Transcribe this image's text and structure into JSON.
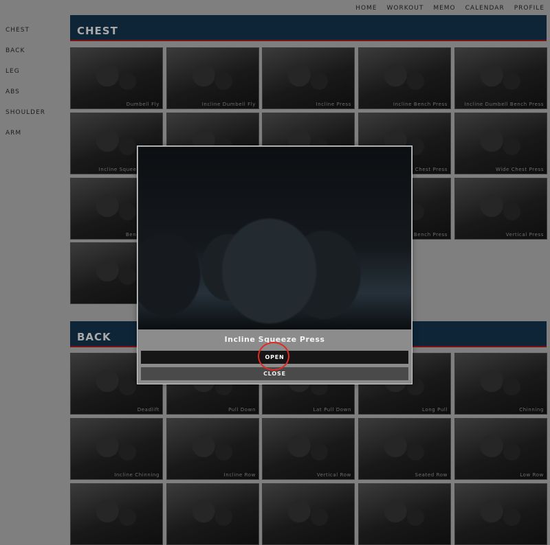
{
  "nav": {
    "items": [
      "HOME",
      "WORKOUT",
      "MEMO",
      "CALENDAR",
      "PROFILE"
    ]
  },
  "sidebar": {
    "items": [
      "CHEST",
      "BACK",
      "LEG",
      "ABS",
      "SHOULDER",
      "ARM"
    ]
  },
  "sections": [
    {
      "title": "CHEST",
      "tiles": [
        "Dumbell Fly",
        "Incline Dumbell Fly",
        "Incline Press",
        "Incline Bench Press",
        "Incline Dumbell Bench Press",
        "Incline Squeeze Press",
        "",
        "",
        "Chest Press",
        "Wide Chest Press",
        "Bench Press",
        "",
        "",
        "Bench Press",
        "Vertical Press",
        ""
      ]
    },
    {
      "title": "BACK",
      "tiles": [
        "Deadlift",
        "Pull Down",
        "Lat Pull Down",
        "Long Pull",
        "Chinning",
        "Incline Chinning",
        "Incline Row",
        "Vertical Row",
        "Seated Row",
        "Low Row",
        "",
        "",
        "",
        "",
        ""
      ]
    }
  ],
  "modal": {
    "title": "Incline Squeeze Press",
    "open_label": "OPEN",
    "close_label": "CLOSE"
  },
  "colors": {
    "header_bg": "#0d2536",
    "header_underline": "#7a1212",
    "overlay": "#7f7f7f",
    "click_ring": "#e02a22"
  }
}
